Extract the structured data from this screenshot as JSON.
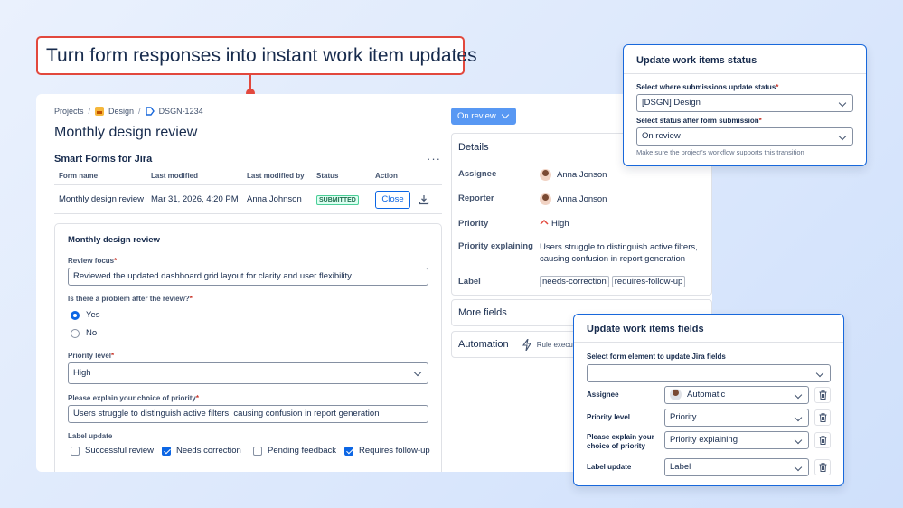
{
  "headline": "Turn form responses into instant work item updates",
  "breadcrumb": {
    "projects": "Projects",
    "project": "Design",
    "issue": "DSGN-1234"
  },
  "page_title": "Monthly design review",
  "smart_forms": {
    "title": "Smart Forms for Jira",
    "more": "···",
    "headers": [
      "Form name",
      "Last modified",
      "Last modified by",
      "Status",
      "Action"
    ],
    "row": {
      "name": "Monthly design review",
      "modified": "Mar 31, 2026, 4:20 PM",
      "by": "Anna Johnson",
      "status": "SUBMITTED",
      "action": "Close"
    }
  },
  "form": {
    "title": "Monthly design review",
    "review_focus_label": "Review focus",
    "review_focus_value": "Reviewed the updated dashboard grid layout for clarity and user flexibility",
    "problem_label": "Is there a problem after the review?",
    "options": [
      "Yes",
      "No"
    ],
    "selected_option": "Yes",
    "priority_label": "Priority level",
    "priority_value": "High",
    "explain_label": "Please explain your choice of priority",
    "explain_value": "Users struggle to distinguish active filters, causing confusion in report generation",
    "label_update_label": "Label update",
    "checkboxes": [
      {
        "label": "Successful review",
        "checked": false
      },
      {
        "label": "Needs correction",
        "checked": true
      },
      {
        "label": "Pending feedback",
        "checked": false
      },
      {
        "label": "Requires follow-up",
        "checked": true
      }
    ]
  },
  "status_button": "On review",
  "details": {
    "title": "Details",
    "assignee_label": "Assignee",
    "assignee": "Anna Jonson",
    "reporter_label": "Reporter",
    "reporter": "Anna Jonson",
    "priority_label": "Priority",
    "priority": "High",
    "explaining_label": "Priority explaining",
    "explaining_line1": "Users struggle to distinguish active filters,",
    "explaining_line2": "causing confusion in report generation",
    "label_label": "Label",
    "labels": [
      "needs-correction",
      "requires-follow-up"
    ]
  },
  "more_fields": "More fields",
  "automation": {
    "title": "Automation",
    "rule": "Rule executi"
  },
  "status_popup": {
    "title": "Update work items status",
    "where_label": "Select where submissions update status",
    "where_value": "[DSGN] Design",
    "after_label": "Select status after form submission",
    "after_value": "On review",
    "hint": "Make sure the project's workflow supports this transition"
  },
  "fields_popup": {
    "title": "Update work items fields",
    "select_label": "Select form element to update Jira fields",
    "select_value": "",
    "mappings": [
      {
        "label_1": "Assignee",
        "label_2": "",
        "value": "Automatic"
      },
      {
        "label_1": "Priority level",
        "label_2": "",
        "value": "Priority"
      },
      {
        "label_1": "Please explain your",
        "label_2": "choice of priority",
        "value": "Priority explaining"
      },
      {
        "label_1": "Label update",
        "label_2": "",
        "value": "Label"
      }
    ]
  },
  "colors": {
    "accent": "#e2483d",
    "brand": "#0c66e4",
    "status_button": "#5898f3"
  }
}
